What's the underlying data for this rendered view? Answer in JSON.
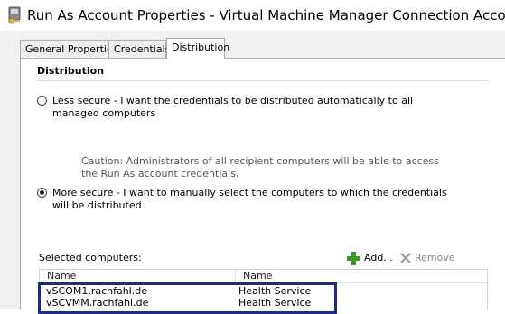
{
  "window": {
    "title": "Run As Account Properties - Virtual Machine Manager Connection Accou..."
  },
  "tabs": [
    {
      "label": "General Properties",
      "active": false
    },
    {
      "label": "Credentials",
      "active": false
    },
    {
      "label": "Distribution",
      "active": true
    }
  ],
  "distribution": {
    "heading": "Distribution",
    "options": [
      {
        "label": "Less secure - I want the credentials to be distributed automatically to all managed computers",
        "checked": false
      },
      {
        "label": "More secure - I want to manually select the computers to which the credentials will be distributed",
        "checked": true
      }
    ],
    "caution": "Caution: Administrators of all recipient computers will be able to access the Run As account credentials.",
    "selected_label": "Selected computers:",
    "add_label": "Add...",
    "remove_label": "Remove",
    "columns": [
      "Name",
      "Name"
    ],
    "rows": [
      {
        "computer": "vSCOM1.rachfahl.de",
        "service": "Health Service"
      },
      {
        "computer": "vSCVMM.rachfahl.de",
        "service": "Health Service"
      }
    ]
  },
  "icons": {
    "app": "run-as-account-icon",
    "add": "plus-icon",
    "remove": "x-icon"
  },
  "colors": {
    "highlight": "#1d2a8f",
    "add_plus": "#3a9a2a",
    "disabled_text": "#8a8a8a"
  }
}
